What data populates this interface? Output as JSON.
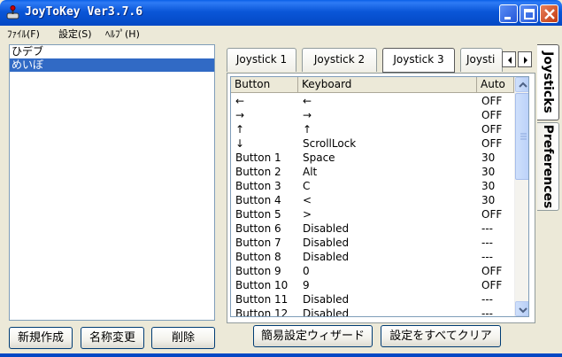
{
  "window": {
    "title": "JoyToKey Ver3.7.6"
  },
  "menu": [
    {
      "label": "ﾌｧｲﾙ(F)"
    },
    {
      "label": "設定(S)"
    },
    {
      "label": "ﾍﾙﾌﾟ(H)"
    }
  ],
  "profiles": {
    "items": [
      {
        "label": "ひデブ",
        "selected": false
      },
      {
        "label": "めいぼ",
        "selected": true
      }
    ]
  },
  "left_buttons": {
    "new_label": "新規作成",
    "rename_label": "名称変更",
    "delete_label": "削除"
  },
  "tabs": [
    {
      "label": "Joystick 1"
    },
    {
      "label": "Joystick 2"
    },
    {
      "label": "Joystick 3",
      "active": true
    },
    {
      "label": "Joysti"
    }
  ],
  "grid": {
    "headers": {
      "button": "Button",
      "keyboard": "Keyboard",
      "auto": "Auto"
    },
    "rows": [
      {
        "button": "←",
        "keyboard": "←",
        "auto": "OFF"
      },
      {
        "button": "→",
        "keyboard": "→",
        "auto": "OFF"
      },
      {
        "button": "↑",
        "keyboard": "↑",
        "auto": "OFF"
      },
      {
        "button": "↓",
        "keyboard": "ScrollLock",
        "auto": "OFF"
      },
      {
        "button": "Button 1",
        "keyboard": "Space",
        "auto": "30"
      },
      {
        "button": "Button 2",
        "keyboard": "Alt",
        "auto": "30"
      },
      {
        "button": "Button 3",
        "keyboard": "C",
        "auto": "30"
      },
      {
        "button": "Button 4",
        "keyboard": "<",
        "auto": "30"
      },
      {
        "button": "Button 5",
        "keyboard": ">",
        "auto": "OFF"
      },
      {
        "button": "Button 6",
        "keyboard": "Disabled",
        "auto": "---"
      },
      {
        "button": "Button 7",
        "keyboard": "Disabled",
        "auto": "---"
      },
      {
        "button": "Button 8",
        "keyboard": "Disabled",
        "auto": "---"
      },
      {
        "button": "Button 9",
        "keyboard": "0",
        "auto": "OFF"
      },
      {
        "button": "Button 10",
        "keyboard": "9",
        "auto": "OFF"
      },
      {
        "button": "Button 11",
        "keyboard": "Disabled",
        "auto": "---"
      },
      {
        "button": "Button 12",
        "keyboard": "Disabled",
        "auto": "---"
      }
    ]
  },
  "bottom_buttons": {
    "wizard_label": "簡易設定ウィザード",
    "clear_label": "設定をすべてクリア"
  },
  "side_tabs": [
    {
      "label": "Joysticks",
      "active": true
    },
    {
      "label": "Preferences",
      "active": false
    }
  ],
  "icons": {
    "app": "joystick-icon",
    "minimize": "minimize-icon",
    "maximize": "maximize-icon",
    "close": "close-icon",
    "tab_prev": "chevron-left-icon",
    "tab_next": "chevron-right-icon",
    "scroll_up": "chevron-up-icon",
    "scroll_down": "chevron-down-icon"
  },
  "colors": {
    "titlebar": "#0348c4",
    "selection": "#316ac5",
    "face": "#ece9d8"
  }
}
